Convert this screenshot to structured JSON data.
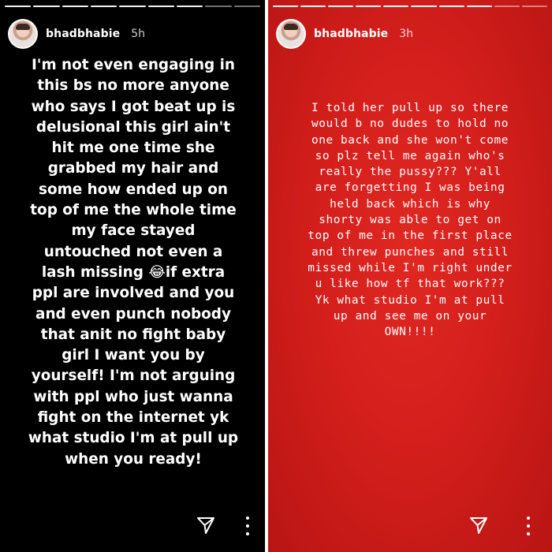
{
  "stories": [
    {
      "username": "bhadbhabie",
      "time": "5h",
      "text": "I'm not even engaging in\nthis bs no more anyone\nwho says I got beat up is\ndelusional this girl ain't\nhit me one time she\ngrabbed my hair and\nsome how ended up on\ntop of me the whole time\nmy face stayed\nuntouched not even a\nlash missing 😂if extra\nppl are involved and you\nand even punch nobody\nthat anit no fight baby\ngirl I want you by\nyourself! I'm not arguing\nwith ppl who just wanna\nfight on the internet yk\nwhat studio I'm at pull up\nwhen you ready!",
      "background": "#000000",
      "icons": [
        "send-icon",
        "more-icon"
      ]
    },
    {
      "username": "bhadbhabie",
      "time": "3h",
      "text": "I told her pull up so there\nwould b no dudes to hold no\none back and she won't come\nso plz tell me again who's\nreally the pussy??? Y'all\nare forgetting I was being\nheld back which is why\nshorty was able to get on\ntop of me in the first place\nand threw punches and still\nmissed while I'm right under\nu like how tf that work???\nYk what studio I'm at pull\nup and see me on your\nOWN!!!!",
      "background": "#d41f1c",
      "icons": [
        "send-icon",
        "more-icon"
      ]
    }
  ]
}
